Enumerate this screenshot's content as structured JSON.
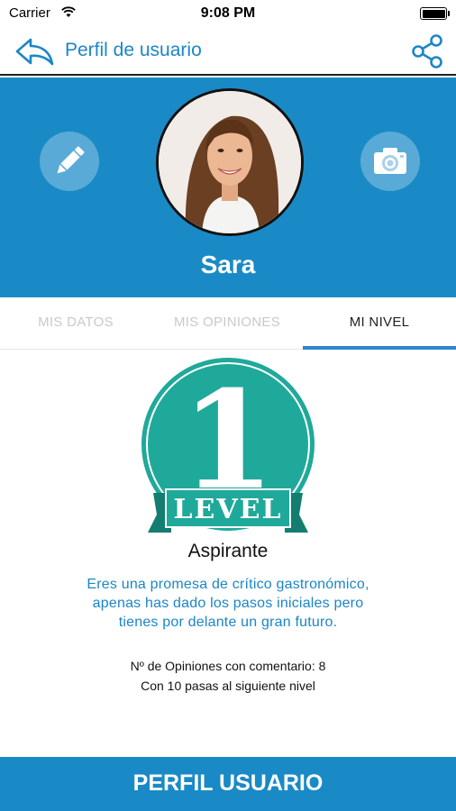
{
  "status_bar": {
    "carrier": "Carrier",
    "time": "9:08 PM",
    "wifi_icon": "wifi-icon",
    "battery_level": 1.0
  },
  "nav": {
    "title": "Perfil de usuario",
    "back_icon": "back-arrow-icon",
    "share_icon": "share-icon"
  },
  "profile": {
    "name": "Sara",
    "edit_icon": "pencil-icon",
    "camera_icon": "camera-icon",
    "avatar": "profile-photo"
  },
  "tabs": [
    {
      "label": "MIS DATOS",
      "active": false
    },
    {
      "label": "MIS OPINIONES",
      "active": false
    },
    {
      "label": "MI NIVEL",
      "active": true
    }
  ],
  "level": {
    "number": "1",
    "ribbon_text": "LEVEL",
    "name": "Aspirante",
    "description": "Eres una promesa de crítico gastronómico, apenas has dado los pasos iniciales pero tienes por delante un gran futuro.",
    "stat_opinions": "Nº de Opiniones con comentario: 8",
    "stat_next": "Con 10 pasas al siguiente nivel"
  },
  "bottom_button": {
    "label": "PERFIL USUARIO"
  },
  "colors": {
    "primary": "#1a8ac6",
    "link": "#1b86c8",
    "badge": "#1fa99a",
    "tab_indicator": "#2e86cf"
  }
}
